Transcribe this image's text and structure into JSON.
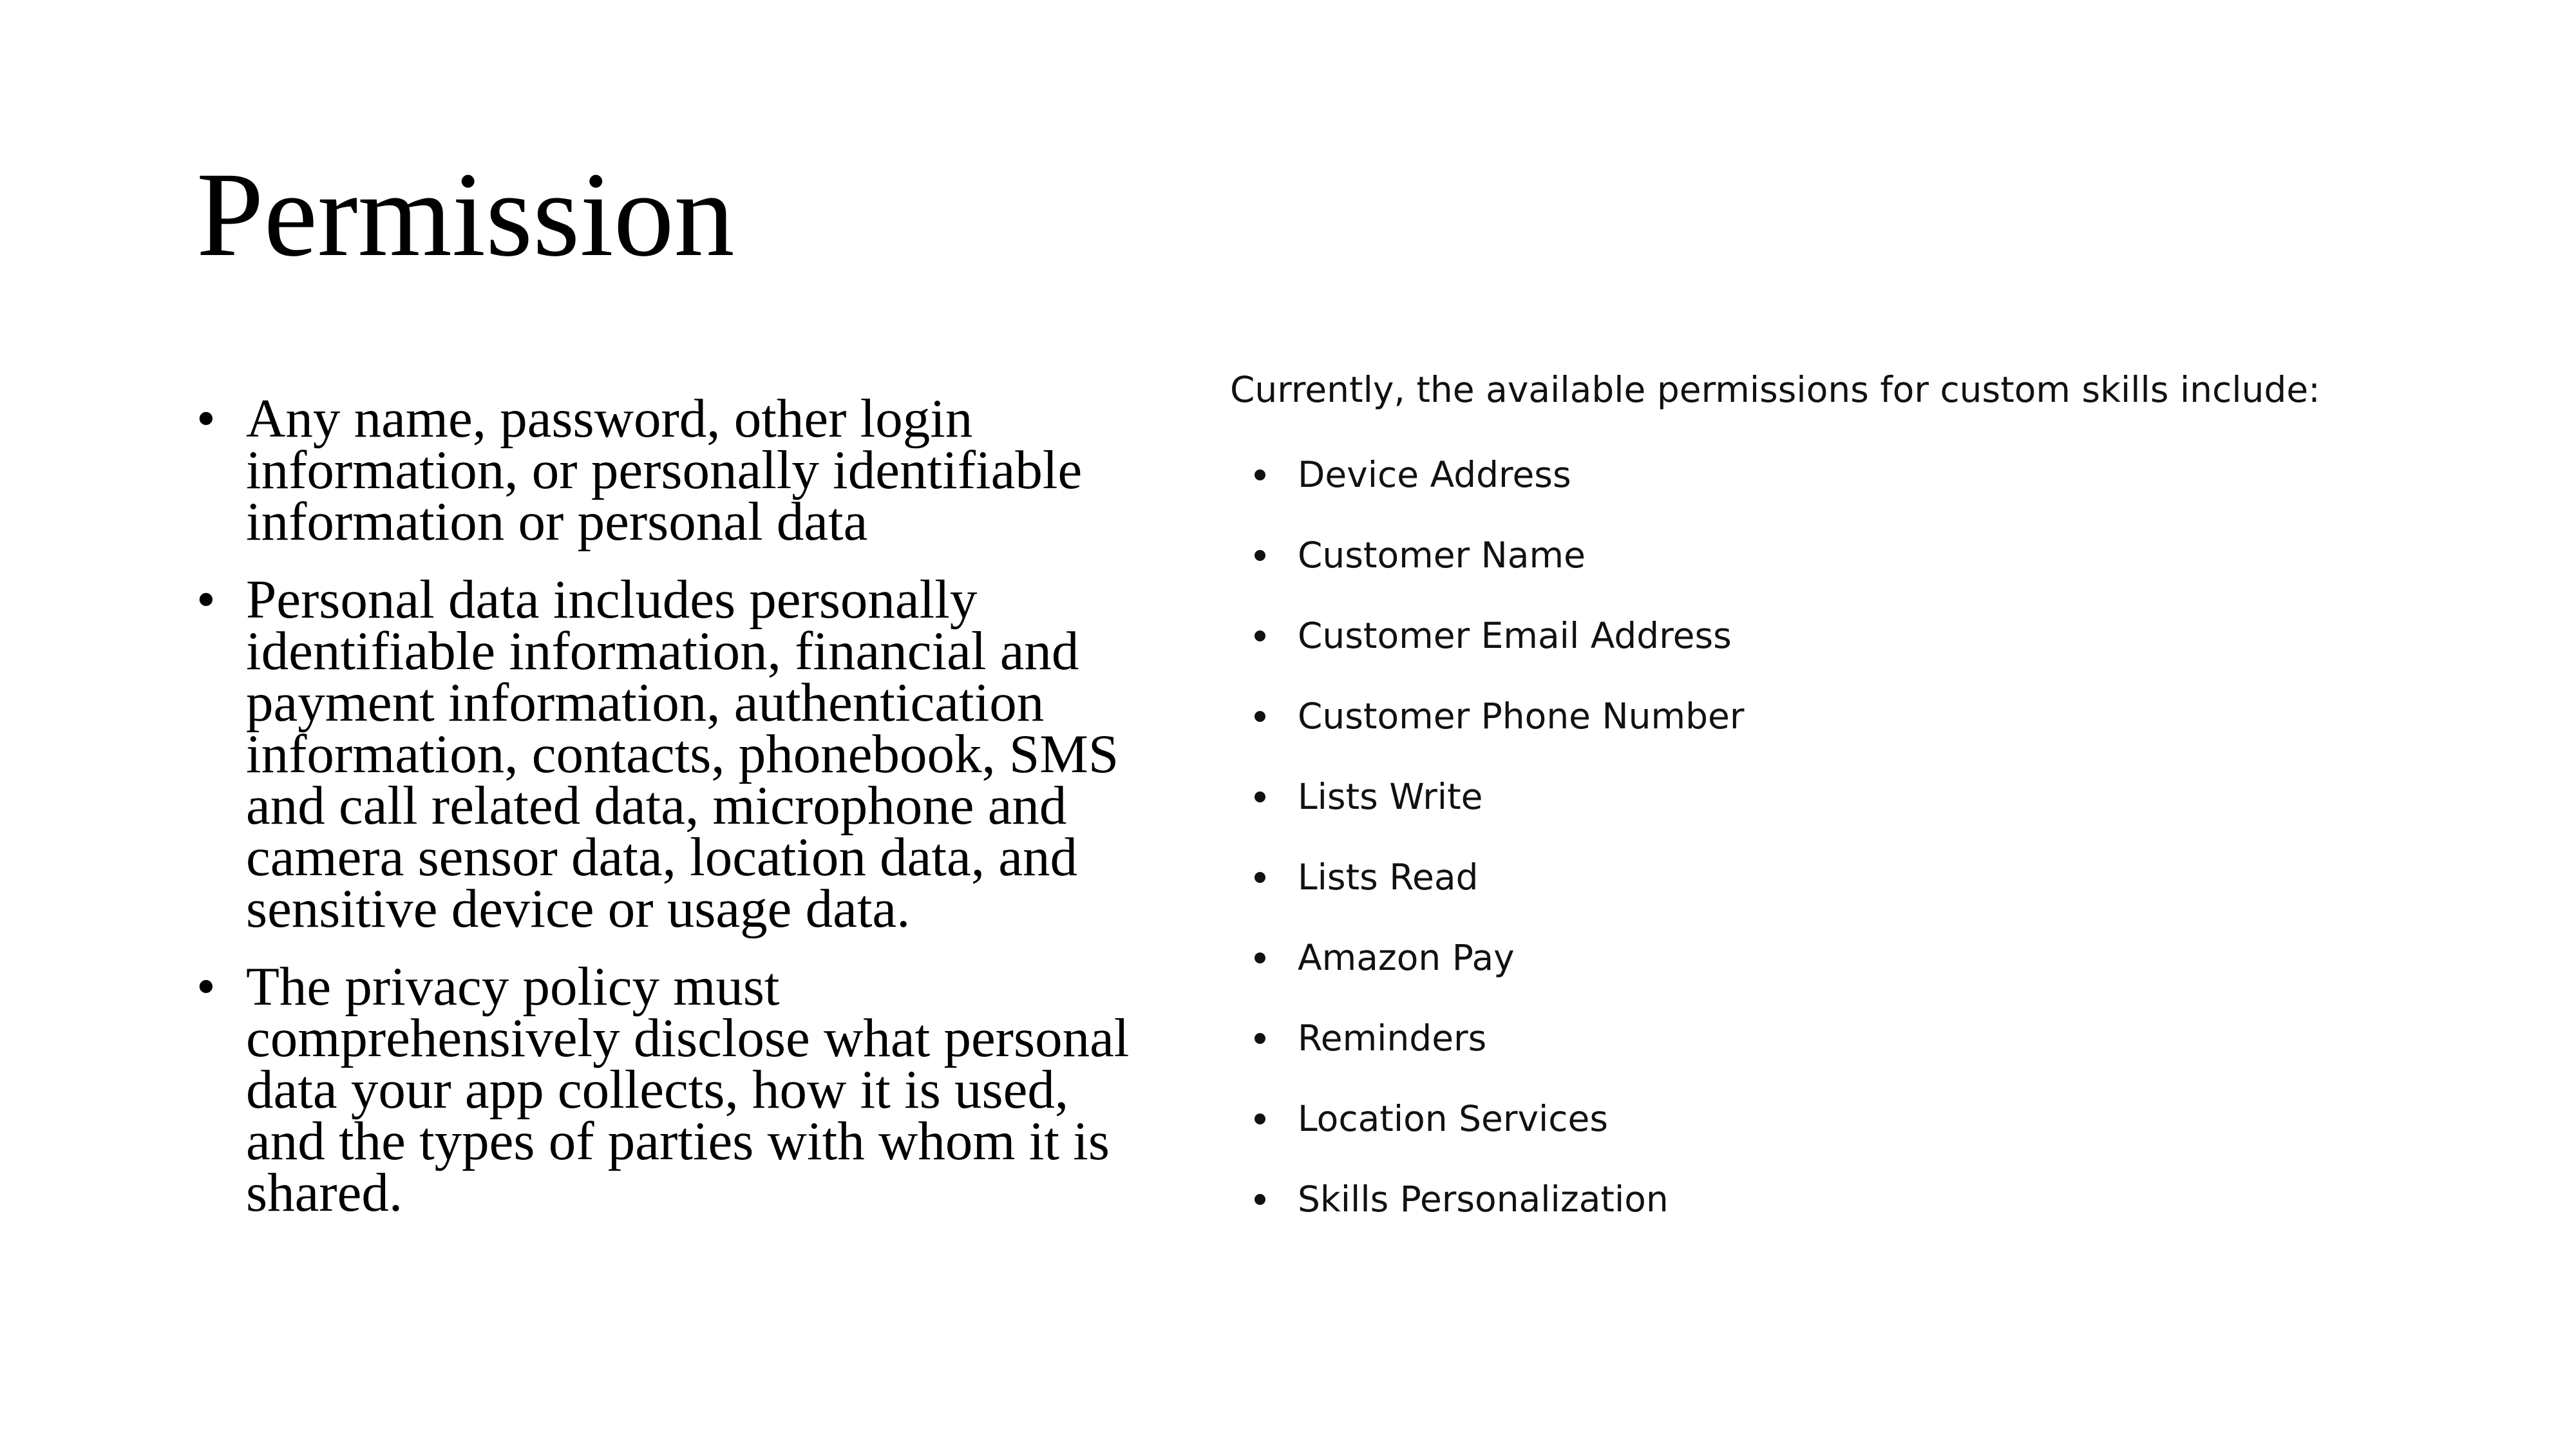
{
  "slide": {
    "title": "Permission",
    "bullets": [
      "Any name, password, other login information, or personally identifiable information or personal data",
      "Personal data includes personally identifiable information, financial and payment information, authentication information, contacts, phonebook, SMS and call related data, microphone and camera sensor data, location data, and sensitive device or usage data.",
      "The privacy policy must comprehensively disclose what personal data your app collects, how it is used, and the types of parties with whom it is shared."
    ],
    "bullet_glyph": "•",
    "permissions_intro": "Currently, the available permissions for custom skills include:",
    "permissions": [
      "Device Address",
      "Customer Name",
      "Customer Email Address",
      "Customer Phone Number",
      "Lists Write",
      "Lists Read",
      "Amazon Pay",
      "Reminders",
      "Location Services",
      "Skills Personalization"
    ]
  }
}
